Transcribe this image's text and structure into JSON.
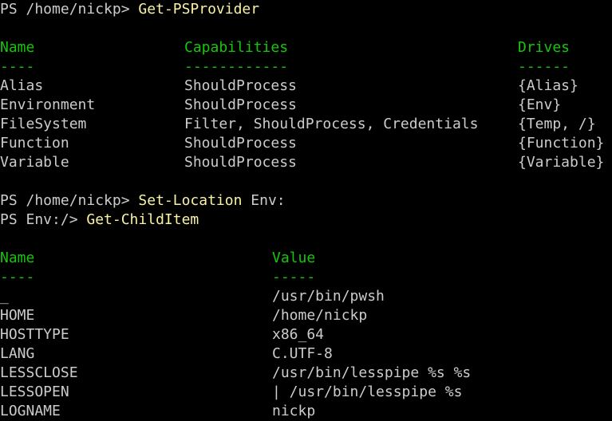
{
  "colors": {
    "background": "#000000",
    "text": "#cccccc",
    "command": "#f9f1a5",
    "header": "#16c60c"
  },
  "session": {
    "cmd1": {
      "prompt": "PS /home/nickp> ",
      "command": "Get-PSProvider"
    },
    "providers": {
      "headers": [
        "Name",
        "Capabilities",
        "Drives"
      ],
      "underlines": [
        "----",
        "------------",
        "------"
      ],
      "rows": [
        [
          "Alias",
          "ShouldProcess",
          "{Alias}"
        ],
        [
          "Environment",
          "ShouldProcess",
          "{Env}"
        ],
        [
          "FileSystem",
          "Filter, ShouldProcess, Credentials",
          "{Temp, /}"
        ],
        [
          "Function",
          "ShouldProcess",
          "{Function}"
        ],
        [
          "Variable",
          "ShouldProcess",
          "{Variable}"
        ]
      ]
    },
    "cmd2": {
      "prompt": "PS /home/nickp> ",
      "command": "Set-Location",
      "argument": " Env:"
    },
    "cmd3": {
      "prompt": "PS Env:/> ",
      "command": "Get-ChildItem"
    },
    "env": {
      "headers": [
        "Name",
        "Value"
      ],
      "underlines": [
        "----",
        "-----"
      ],
      "rows": [
        [
          "_",
          "/usr/bin/pwsh"
        ],
        [
          "HOME",
          "/home/nickp"
        ],
        [
          "HOSTTYPE",
          "x86_64"
        ],
        [
          "LANG",
          "C.UTF-8"
        ],
        [
          "LESSCLOSE",
          "/usr/bin/lesspipe %s %s"
        ],
        [
          "LESSOPEN",
          "| /usr/bin/lesspipe %s"
        ],
        [
          "LOGNAME",
          "nickp"
        ]
      ]
    }
  }
}
